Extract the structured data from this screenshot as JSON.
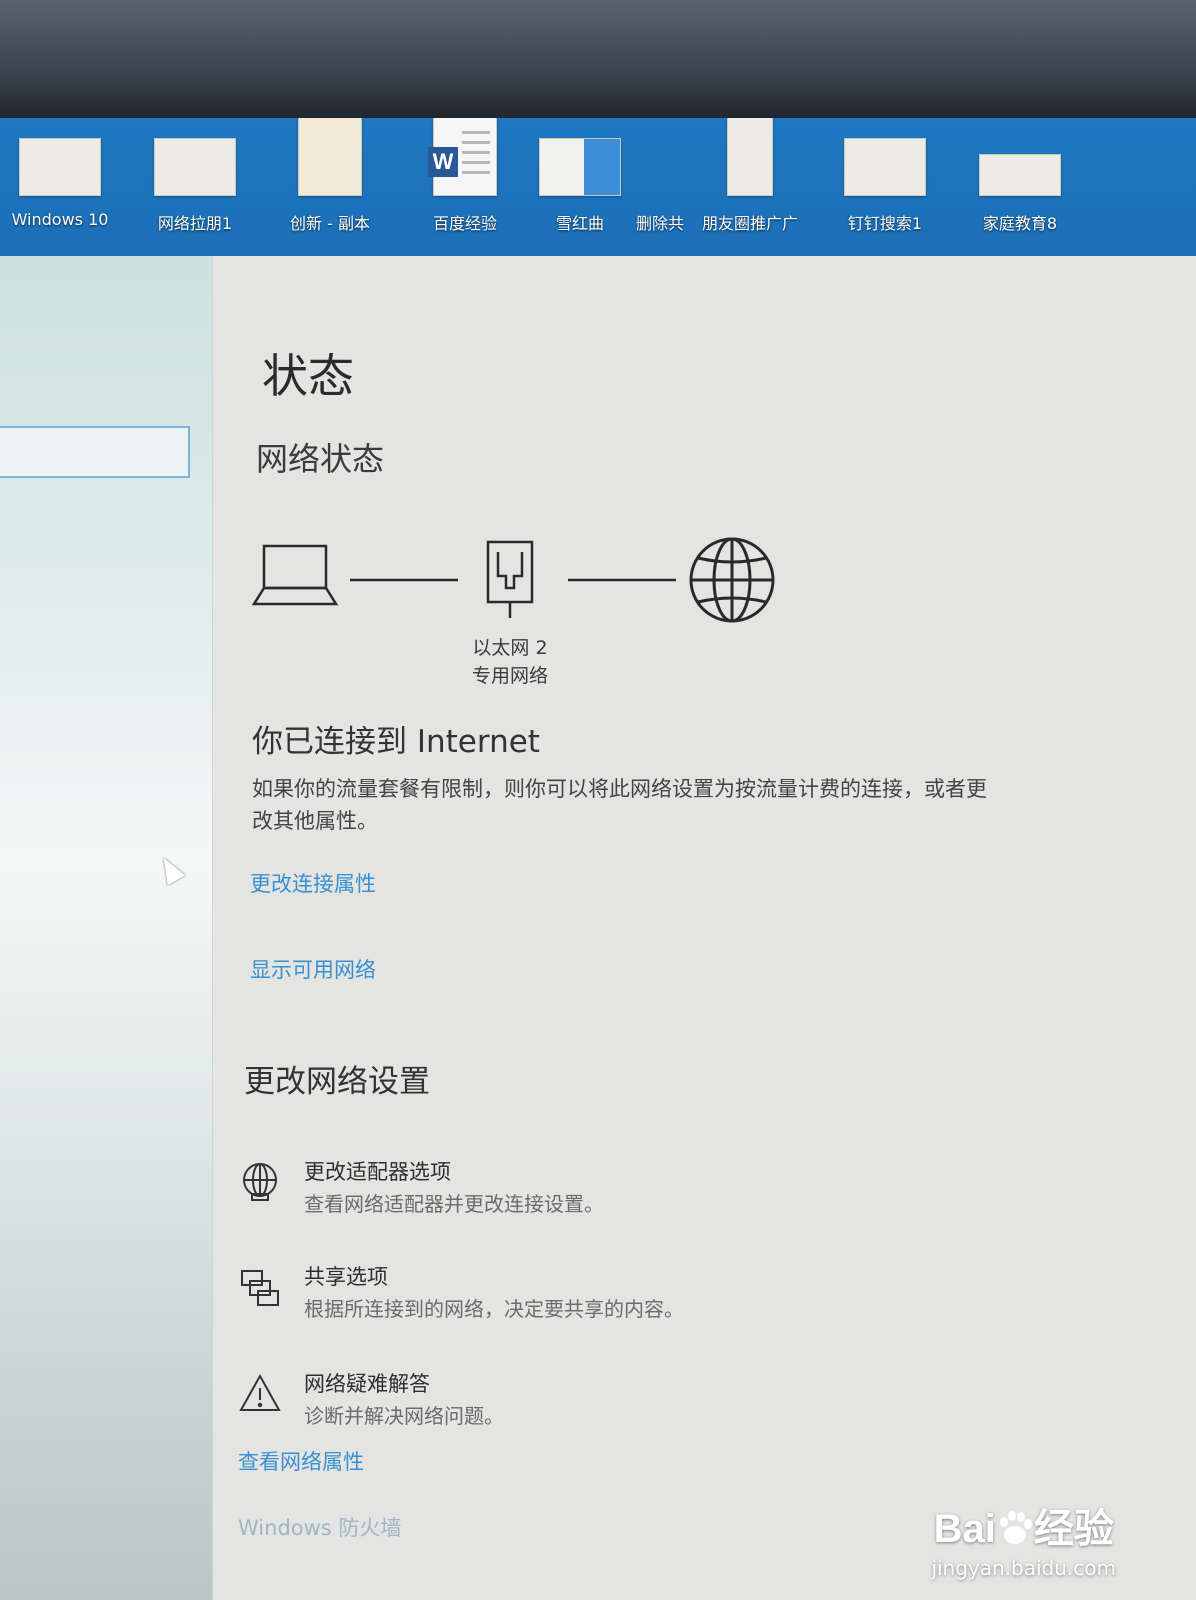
{
  "desktop": {
    "icons": [
      {
        "label": "Windows 10"
      },
      {
        "label": "网络拉朋1"
      },
      {
        "label": "创新 - 副本"
      },
      {
        "label": "百度经验"
      },
      {
        "label": "雪红曲"
      },
      {
        "label": "删除共"
      },
      {
        "label": "朋友圈推广广"
      },
      {
        "label": "钉钉搜索1"
      },
      {
        "label": "家庭教育8"
      }
    ]
  },
  "page": {
    "title": "状态",
    "subtitle": "网络状态"
  },
  "diagram": {
    "adapter_name": "以太网 2",
    "network_type": "专用网络"
  },
  "connection": {
    "heading": "你已连接到 Internet",
    "description": "如果你的流量套餐有限制，则你可以将此网络设置为按流量计费的连接，或者更改其他属性。"
  },
  "links": {
    "change_properties": "更改连接属性",
    "show_networks": "显示可用网络",
    "view_properties": "查看网络属性",
    "firewall": "Windows 防火墙"
  },
  "settings": {
    "section_title": "更改网络设置",
    "options": [
      {
        "title": "更改适配器选项",
        "desc": "查看网络适配器并更改连接设置。",
        "icon": "adapter-globe-icon"
      },
      {
        "title": "共享选项",
        "desc": "根据所连接到的网络，决定要共享的内容。",
        "icon": "sharing-icon"
      },
      {
        "title": "网络疑难解答",
        "desc": "诊断并解决网络问题。",
        "icon": "warning-icon"
      }
    ]
  },
  "watermark": {
    "brand_prefix": "Bai",
    "brand_suffix": "经验",
    "url": "jingyan.baidu.com"
  }
}
